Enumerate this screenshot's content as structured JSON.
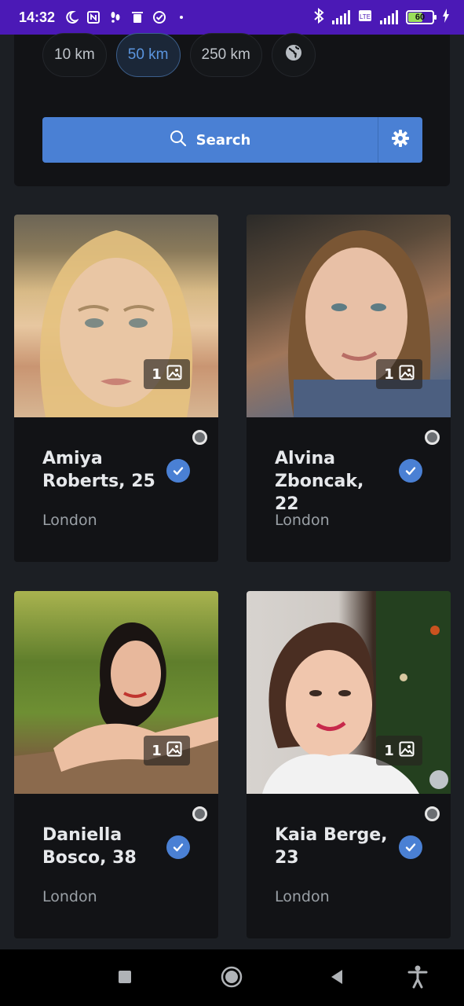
{
  "status_bar": {
    "time": "14:32",
    "battery": "60",
    "icons": [
      "moon-icon",
      "nfc-icon",
      "footsteps-icon",
      "trash-icon",
      "check-circle-icon",
      "dot-icon",
      "bluetooth-icon",
      "signal-icon",
      "volte-icon",
      "4g-signal-icon",
      "battery-icon",
      "charging-icon"
    ]
  },
  "filters": {
    "distances": [
      "10 km",
      "50 km",
      "250 km"
    ],
    "selected": "50 km",
    "globe_icon": "globe-icon"
  },
  "search": {
    "button_label": "Search",
    "icon": "search-icon",
    "settings_icon": "gear-icon"
  },
  "profiles": [
    {
      "name": "Amiya Roberts, 25",
      "city": "London",
      "photos": "1",
      "verified": true
    },
    {
      "name": "Alvina Zboncak, 22",
      "city": "London",
      "photos": "1",
      "verified": true
    },
    {
      "name": "Daniella Bosco, 38",
      "city": "London",
      "photos": "1",
      "verified": true
    },
    {
      "name": "Kaia Berge, 23",
      "city": "London",
      "photos": "1",
      "verified": true
    }
  ],
  "colors": {
    "accent": "#4a80d4",
    "status_bar": "#4b19b6",
    "card_bg": "#121316",
    "page_bg": "#1c1f24"
  },
  "nav": [
    "recent-apps-icon",
    "home-icon",
    "back-icon",
    "accessibility-icon"
  ]
}
